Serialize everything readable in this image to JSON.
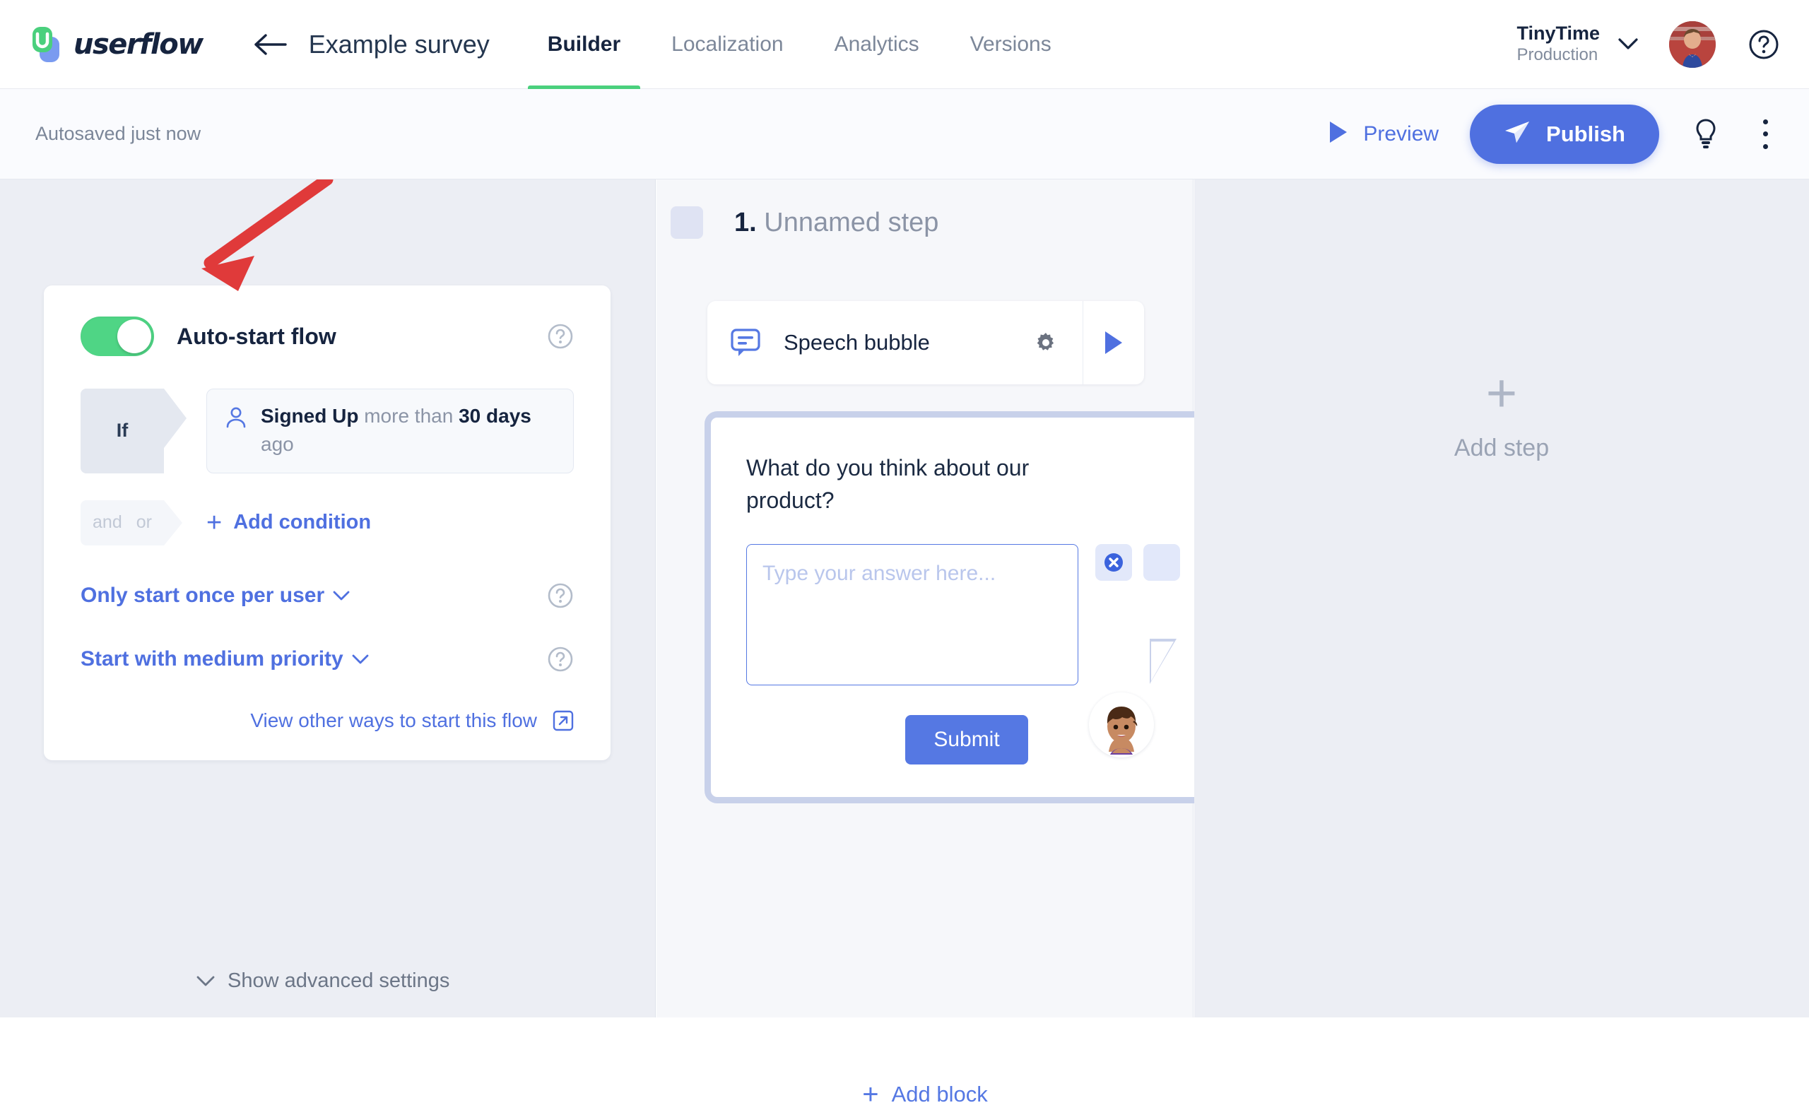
{
  "topbar": {
    "logo_text": "userflow",
    "logo_icon": "userflow-logo-icon",
    "back_icon": "arrow-left-icon",
    "doc_title": "Example survey",
    "tabs": [
      {
        "label": "Builder",
        "active": true
      },
      {
        "label": "Localization",
        "active": false
      },
      {
        "label": "Analytics",
        "active": false
      },
      {
        "label": "Versions",
        "active": false
      }
    ],
    "account": {
      "name": "TinyTime",
      "environment": "Production",
      "chevron_icon": "chevron-down-icon"
    },
    "avatar_icon": "user-avatar",
    "help_icon": "question-circle-icon"
  },
  "toolbar": {
    "autosave_status": "Autosaved just now",
    "preview_label": "Preview",
    "preview_icon": "play-icon",
    "publish_label": "Publish",
    "publish_icon": "paper-plane-icon",
    "bulb_icon": "lightbulb-icon",
    "more_icon": "kebab-menu-icon"
  },
  "left_panel": {
    "toggle_label": "Auto-start flow",
    "toggle_on": true,
    "toggle_help_icon": "question-circle-icon",
    "condition": {
      "if_label": "If",
      "icon": "person-icon",
      "attribute": "Signed Up",
      "operator": "more than",
      "value": "30 days",
      "suffix": "ago"
    },
    "logic": {
      "and_label": "and",
      "or_label": "or"
    },
    "add_condition_label": "Add condition",
    "add_condition_icon": "plus-icon",
    "options": [
      {
        "label": "Only start once per user",
        "help_icon": "question-circle-icon",
        "chevron_icon": "chevron-down-icon"
      },
      {
        "label": "Start with medium priority",
        "help_icon": "question-circle-icon",
        "chevron_icon": "chevron-down-icon"
      }
    ],
    "view_other_label": "View other ways to start this flow",
    "view_other_icon": "external-link-icon",
    "advanced_label": "Show advanced settings",
    "advanced_icon": "chevron-down-icon",
    "annotation_arrow_color": "#e03a3a"
  },
  "center_panel": {
    "step_number": "1.",
    "step_name": "Unnamed step",
    "block": {
      "icon": "speech-bubble-icon",
      "label": "Speech bubble",
      "settings_icon": "gear-icon",
      "play_icon": "play-icon"
    },
    "preview": {
      "question": "What do you think about our product?",
      "answer_value": "",
      "answer_placeholder": "Type your answer here...",
      "close_icon": "close-circle-icon",
      "submit_label": "Submit",
      "avatar_icon": "bot-avatar-icon"
    },
    "add_block_label": "Add block",
    "add_block_icon": "plus-icon"
  },
  "right_panel": {
    "add_step_label": "Add step",
    "add_step_icon": "plus-icon"
  },
  "colors": {
    "brand_blue": "#4f70e0",
    "brand_green": "#4ad07d",
    "ink": "#16243f",
    "muted": "#7b8698",
    "canvas": "#f6f7fa",
    "panel": "#eceef4",
    "annotation_red": "#e03a3a"
  }
}
